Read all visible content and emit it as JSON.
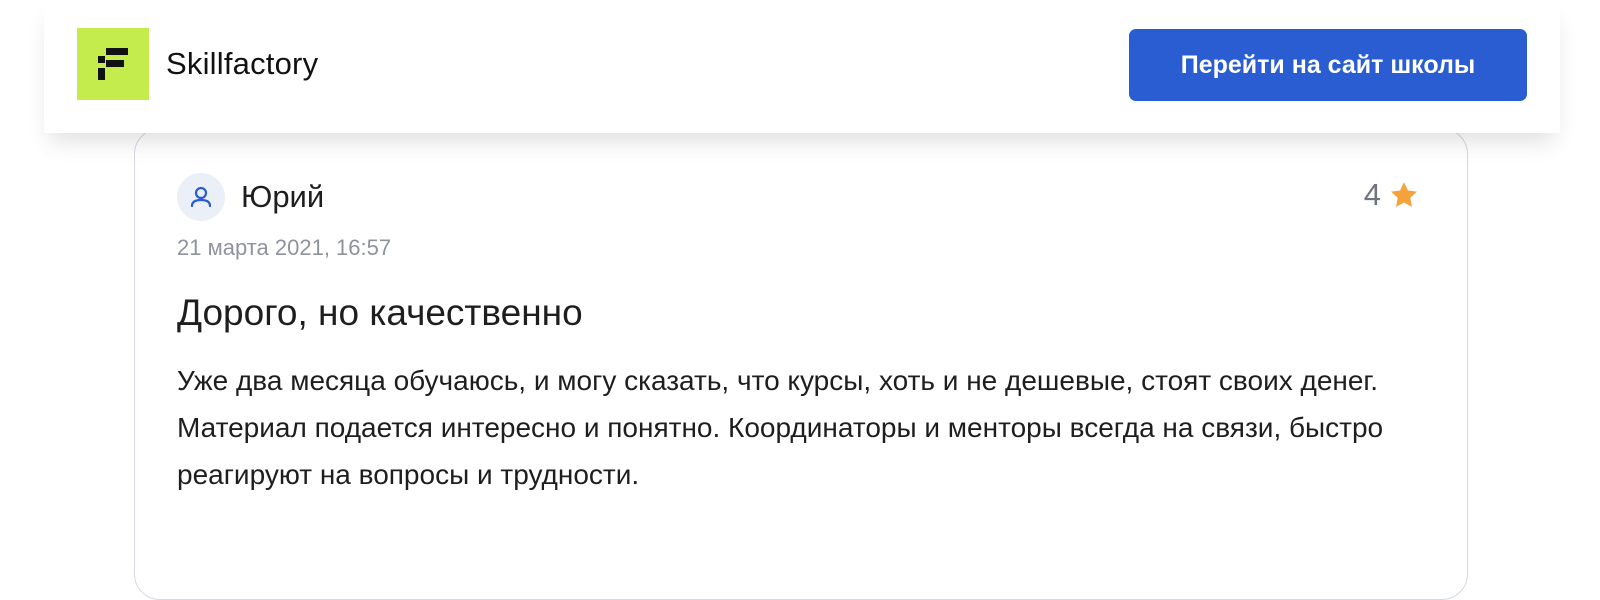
{
  "header": {
    "logo_text": "Skillfactory",
    "cta_label": "Перейти на сайт школы",
    "logo_color": "#c4ec4d",
    "cta_color": "#2a5dd1"
  },
  "review": {
    "author": "Юрий",
    "date": "21 марта 2021, 16:57",
    "rating": "4",
    "title": "Дорого, но качественно",
    "body": "Уже два месяца обучаюсь, и могу сказать, что курсы, хоть и не дешевые, стоят своих денег. Материал подается интересно и понятно. Координаторы и менторы всегда на связи, быстро реагируют на вопросы и трудности.",
    "star_color": "#f5a23a",
    "avatar_icon": "user-icon",
    "rating_icon": "star-icon"
  }
}
